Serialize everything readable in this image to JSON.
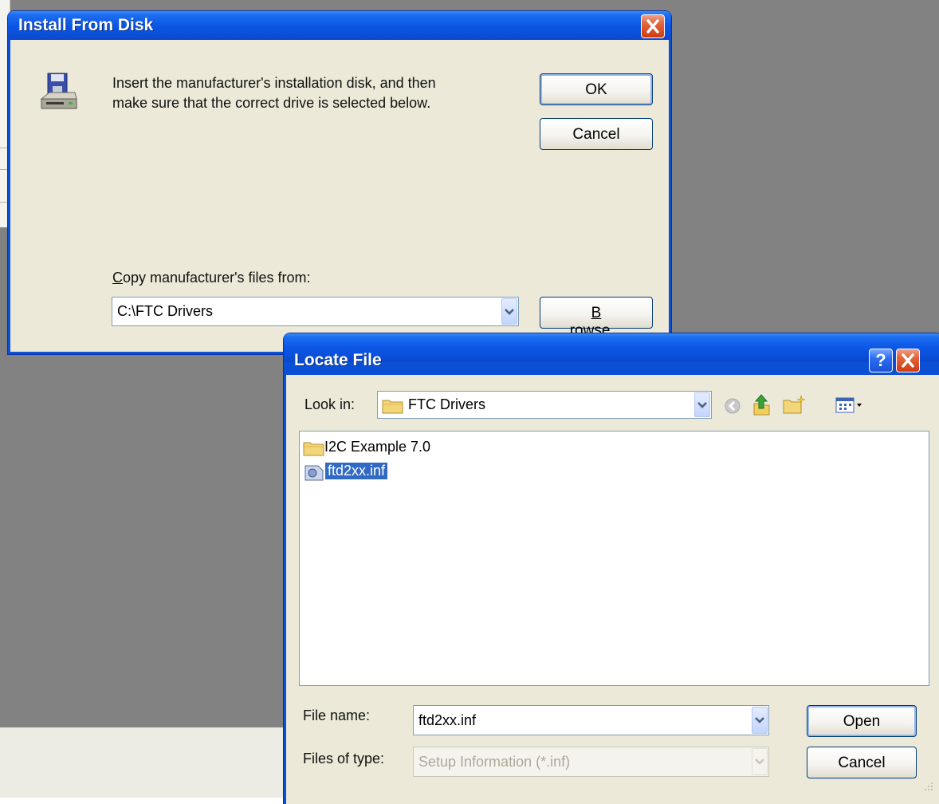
{
  "install_dialog": {
    "title": "Install From Disk",
    "message_line1": "Insert the manufacturer's installation disk, and then",
    "message_line2": "make sure that the correct drive is selected below.",
    "ok_label": "OK",
    "cancel_label": "Cancel",
    "copy_label_accel": "C",
    "copy_label_rest": "opy manufacturer's files from:",
    "path_value": "C:\\FTC Drivers",
    "browse_label_accel": "B",
    "browse_label_rest": "rowse..."
  },
  "locate_dialog": {
    "title": "Locate File",
    "look_in_label": "Look in:",
    "look_in_value": "FTC Drivers",
    "files": [
      {
        "name": "I2C Example 7.0",
        "type": "folder"
      },
      {
        "name": "ftd2xx.inf",
        "type": "inf",
        "selected": true
      }
    ],
    "file_name_label": "File name:",
    "file_name_value": "ftd2xx.inf",
    "files_of_type_label": "Files of type:",
    "files_of_type_value": "Setup Information (*.inf)",
    "open_label": "Open",
    "cancel_label": "Cancel",
    "help_glyph": "?"
  },
  "colors": {
    "titlebar_blue": "#0a4fd4",
    "dialog_face": "#ece9d8",
    "selection": "#316ac5",
    "desktop_gray": "#828282"
  },
  "icons": [
    "floppy-drive-icon",
    "close-icon",
    "help-icon",
    "folder-icon",
    "inf-file-icon",
    "back-icon",
    "up-folder-icon",
    "new-folder-icon",
    "views-menu-icon",
    "chevron-down-icon"
  ]
}
